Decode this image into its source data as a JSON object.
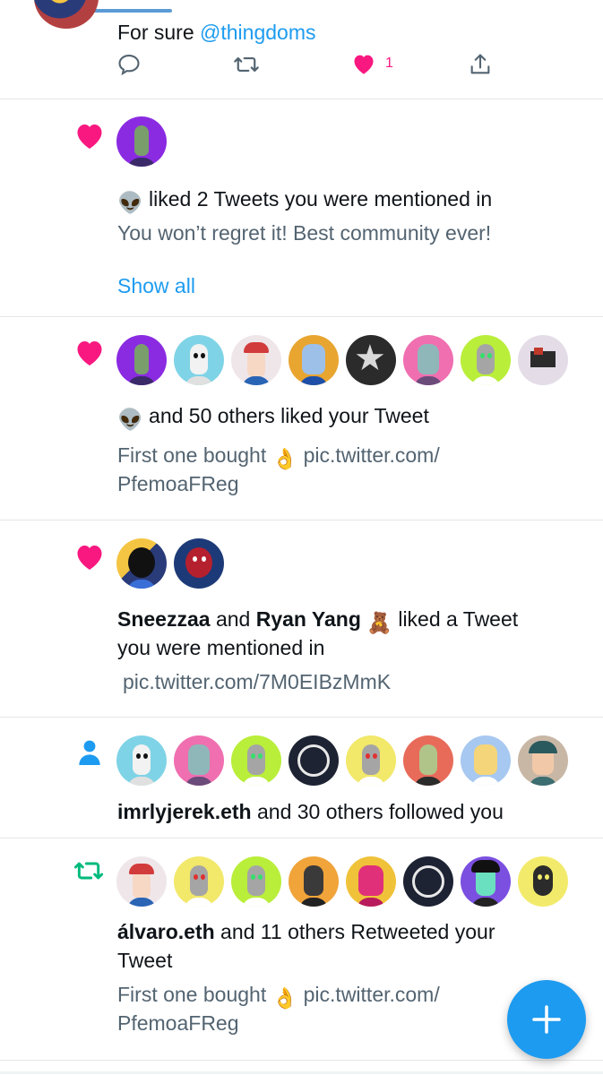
{
  "colors": {
    "accent": "#1d9bf0",
    "like": "#f91880",
    "retweet": "#00ba7c",
    "muted": "#536471"
  },
  "tweet": {
    "text_prefix": "For sure",
    "mention": "@thingdoms",
    "like_count": "1",
    "icons": [
      "reply-icon",
      "retweet-icon",
      "like-icon",
      "share-icon"
    ]
  },
  "notifications": [
    {
      "type": "like",
      "icon": "heart-icon",
      "avatars": [
        "avatar-1"
      ],
      "actor_emoji": "👽",
      "title": "liked 2 Tweets you were mentioned in",
      "body": "You won’t regret it! Best community ever!",
      "show_all": "Show all"
    },
    {
      "type": "like",
      "icon": "heart-icon",
      "avatars": [
        "avatar-1",
        "avatar-2",
        "avatar-3",
        "avatar-4",
        "avatar-5",
        "avatar-6",
        "avatar-7",
        "avatar-8"
      ],
      "actor_emoji": "👽",
      "title": "and 50 others liked your Tweet",
      "body_line1_prefix": "First one bought",
      "body_emoji": "👌",
      "body_line1_link": "pic.twitter.com/",
      "body_line2": "PfemoaFReg"
    },
    {
      "type": "like",
      "icon": "heart-icon",
      "avatars": [
        "avatar-1",
        "avatar-2"
      ],
      "name1": "Sneezzaa",
      "and": "and",
      "name2": "Ryan Yang",
      "name2_emoji": "🧸",
      "title_line1_rest": "liked a Tweet",
      "title_line2": "you were mentioned in",
      "body": "pic.twitter.com/7M0EIBzMmK"
    },
    {
      "type": "follow",
      "icon": "person-icon",
      "avatars": [
        "avatar-1",
        "avatar-2",
        "avatar-3",
        "avatar-4",
        "avatar-5",
        "avatar-6",
        "avatar-7",
        "avatar-8"
      ],
      "name": "imrlyjerek.eth",
      "title_rest": "and 30 others followed you"
    },
    {
      "type": "retweet",
      "icon": "retweet-icon",
      "avatars": [
        "avatar-1",
        "avatar-2",
        "avatar-3",
        "avatar-4",
        "avatar-5",
        "avatar-6",
        "avatar-7",
        "avatar-8"
      ],
      "name": "álvaro.eth",
      "title_rest": "and 11 others Retweeted your",
      "title_line2": "Tweet",
      "body_line1_prefix": "First one bought",
      "body_emoji": "👌",
      "body_line1_link": "pic.twitter.com/",
      "body_line2": "PfemoaFReg"
    }
  ],
  "fab": {
    "icon": "plus-icon"
  }
}
